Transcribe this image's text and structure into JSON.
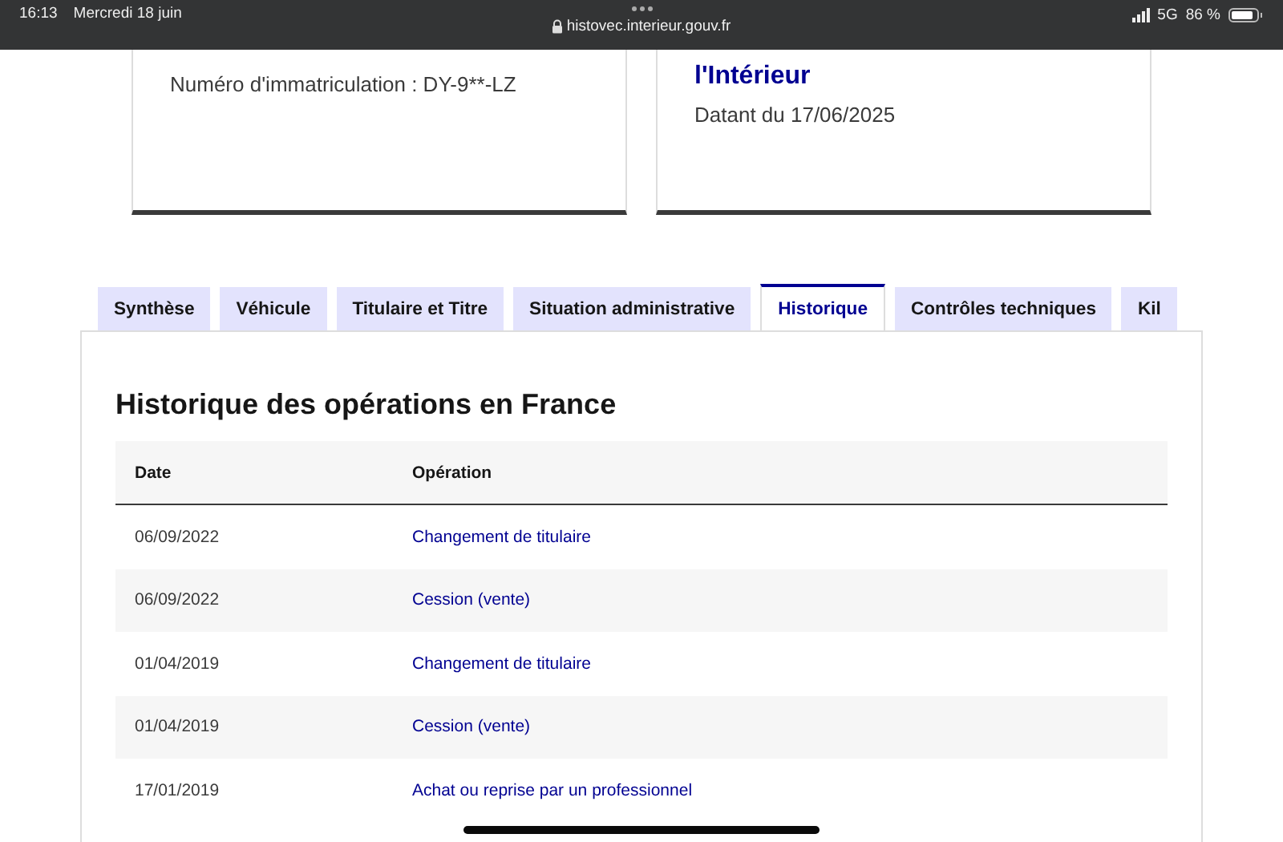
{
  "status_bar": {
    "time": "16:13",
    "date": "Mercredi 18 juin",
    "url": "histovec.interieur.gouv.fr",
    "network": "5G",
    "battery": "86 %"
  },
  "cards": [
    {
      "text": "Numéro d'immatriculation : DY-9**-LZ"
    },
    {
      "title": "l'Intérieur",
      "text": "Datant du 17/06/2025"
    }
  ],
  "tabs": [
    {
      "label": "Synthèse",
      "selected": false
    },
    {
      "label": "Véhicule",
      "selected": false
    },
    {
      "label": "Titulaire et Titre",
      "selected": false
    },
    {
      "label": "Situation administrative",
      "selected": false
    },
    {
      "label": "Historique",
      "selected": true
    },
    {
      "label": "Contrôles techniques",
      "selected": false
    },
    {
      "label": "Kil",
      "selected": false
    }
  ],
  "panel": {
    "heading": "Historique des opérations en France",
    "table": {
      "columns": [
        "Date",
        "Opération"
      ],
      "rows": [
        {
          "date": "06/09/2022",
          "operation": "Changement de titulaire"
        },
        {
          "date": "06/09/2022",
          "operation": "Cession (vente)"
        },
        {
          "date": "01/04/2019",
          "operation": "Changement de titulaire"
        },
        {
          "date": "01/04/2019",
          "operation": "Cession (vente)"
        },
        {
          "date": "17/01/2019",
          "operation": "Achat ou reprise par un professionnel"
        }
      ]
    }
  }
}
